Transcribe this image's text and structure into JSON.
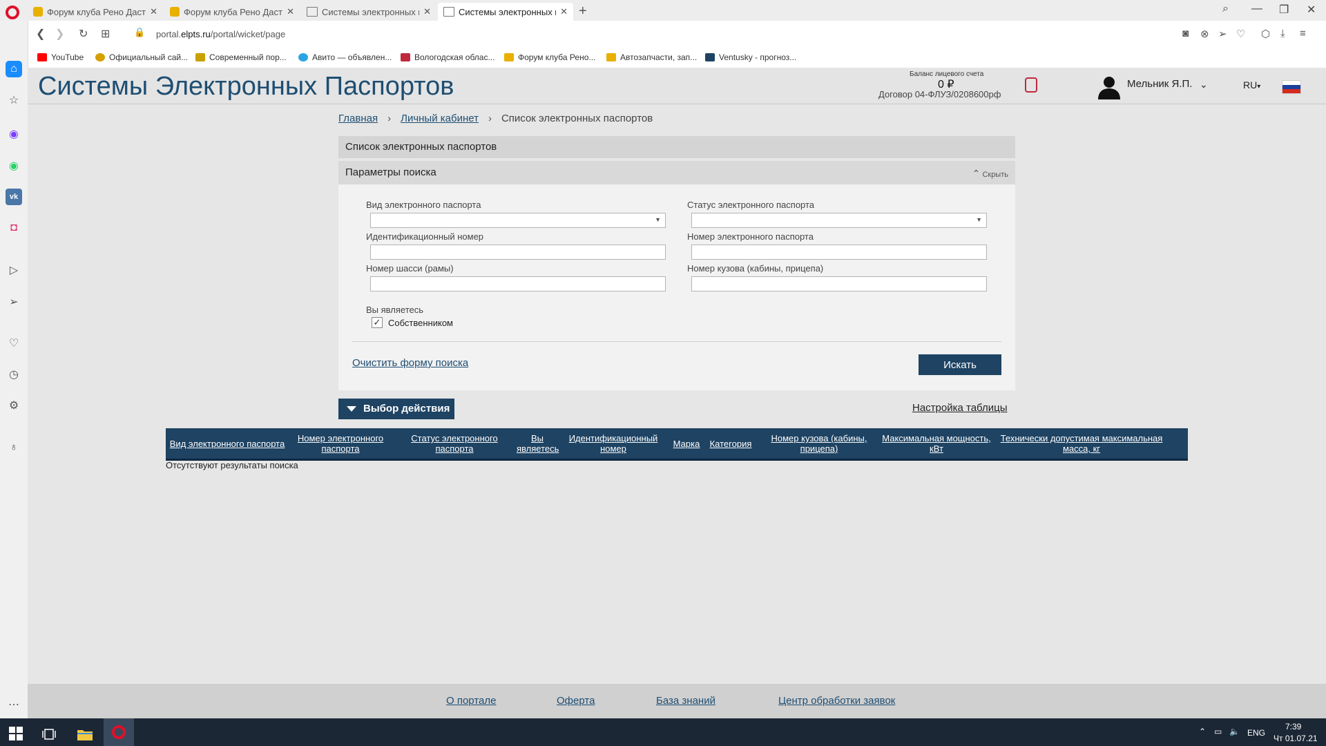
{
  "browser": {
    "tabs": [
      {
        "title": "Форум клуба Рено Дастер"
      },
      {
        "title": "Форум клуба Рено Дастер"
      },
      {
        "title": "Системы электронных пас"
      },
      {
        "title": "Системы электронных пас"
      }
    ],
    "url_prefix": "portal.",
    "url_domain": "elpts.ru",
    "url_path": "/portal/wicket/page",
    "bookmarks": [
      {
        "label": "YouTube",
        "color": "#ff0000"
      },
      {
        "label": "Официальный сай...",
        "color": "#d4a000"
      },
      {
        "label": "Современный пор...",
        "color": "#c9a000"
      },
      {
        "label": "Авито — объявлен...",
        "color": "#2aa5e2"
      },
      {
        "label": "Вологодская облас...",
        "color": "#c0283d"
      },
      {
        "label": "Форум клуба Рено...",
        "color": "#e8b000"
      },
      {
        "label": "Автозапчасти, зап...",
        "color": "#e8b000"
      },
      {
        "label": "Ventusky - прогноз...",
        "color": "#1e4363"
      }
    ]
  },
  "header": {
    "site_title": "Системы Электронных Паспортов",
    "balance_label": "Баланс лицевого счета",
    "balance_value": "0 ₽",
    "contract": "Договор 04-ФЛУЗ/0208600рф",
    "user_name": "Мельник Я.П.",
    "lang": "RU",
    "lang_arrow": "▾"
  },
  "breadcrumb": {
    "home": "Главная",
    "cabinet": "Личный кабинет",
    "current": "Список электронных паспортов",
    "separator": "›"
  },
  "panel_title": "Список электронных паспортов",
  "search": {
    "title": "Параметры поиска",
    "hide_label": "Скрыть",
    "fields": {
      "passport_type_label": "Вид электронного паспорта",
      "passport_type_value": "",
      "passport_status_label": "Статус электронного паспорта",
      "passport_status_value": "",
      "vin_label": "Идентификационный номер",
      "vin_value": "",
      "passport_number_label": "Номер электронного паспорта",
      "passport_number_value": "",
      "chassis_label": "Номер шасси (рамы)",
      "chassis_value": "",
      "body_label": "Номер кузова (кабины, прицепа)",
      "body_value": ""
    },
    "you_are_label": "Вы являетесь",
    "owner_label": "Собственником",
    "owner_checked": "✓",
    "clear_label": "Очистить форму поиска",
    "search_button": "Искать"
  },
  "actions": {
    "action_button": "Выбор действия",
    "table_settings": "Настройка таблицы"
  },
  "table": {
    "columns": [
      "Вид электронного паспорта",
      "Номер электронного паспорта",
      "Статус электронного паспорта",
      "Вы являетесь",
      "Идентификационный номер",
      "Марка",
      "Категория",
      "Номер кузова (кабины, прицепа)",
      "Максимальная мощность, кВт",
      "Технически допустимая максимальная масса, кг"
    ],
    "empty_message": "Отсутствуют результаты поиска"
  },
  "footer": {
    "links": [
      "О портале",
      "Оферта",
      "База знаний",
      "Центр обработки заявок"
    ]
  },
  "taskbar": {
    "lang": "ENG",
    "time": "7:39",
    "date": "Чт 01.07.21"
  }
}
